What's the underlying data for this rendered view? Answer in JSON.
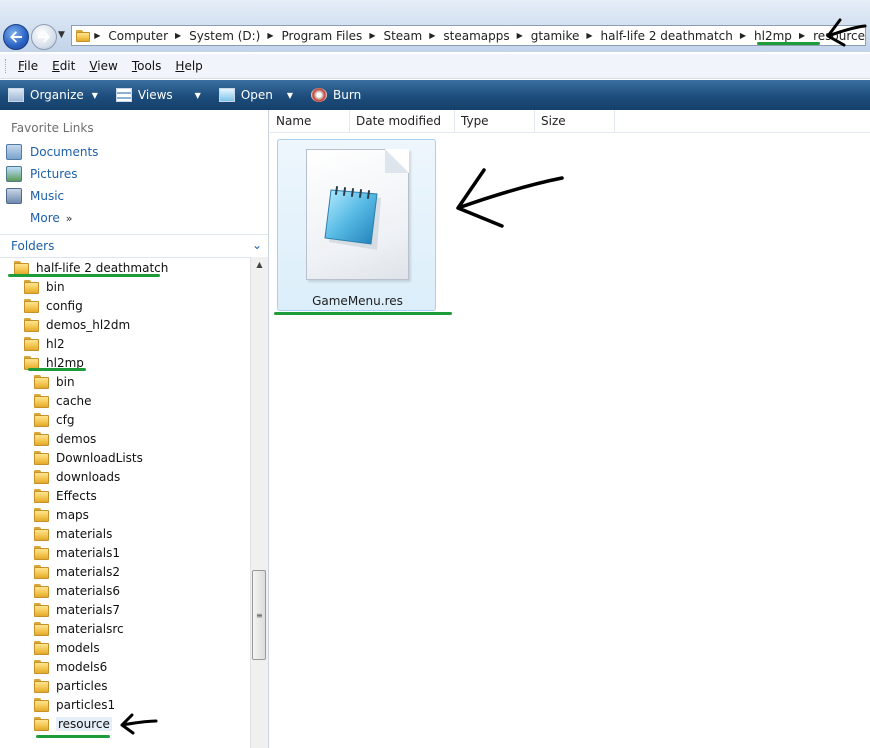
{
  "breadcrumb": [
    "Computer",
    "System (D:)",
    "Program Files",
    "Steam",
    "steamapps",
    "gtamike",
    "half-life 2 deathmatch",
    "hl2mp",
    "resource"
  ],
  "menu": [
    {
      "label": "File",
      "u": "F",
      "rest": "ile"
    },
    {
      "label": "Edit",
      "u": "E",
      "rest": "dit"
    },
    {
      "label": "View",
      "u": "V",
      "rest": "iew"
    },
    {
      "label": "Tools",
      "u": "T",
      "rest": "ools"
    },
    {
      "label": "Help",
      "u": "H",
      "rest": "elp"
    }
  ],
  "commands": {
    "organize": "Organize",
    "views": "Views",
    "open": "Open",
    "burn": "Burn"
  },
  "favorites": {
    "title": "Favorite Links",
    "documents": "Documents",
    "pictures": "Pictures",
    "music": "Music",
    "more": "More"
  },
  "folders_label": "Folders",
  "tree": [
    {
      "label": "half-life 2 deathmatch",
      "level": 0
    },
    {
      "label": "bin",
      "level": 1
    },
    {
      "label": "config",
      "level": 1
    },
    {
      "label": "demos_hl2dm",
      "level": 1
    },
    {
      "label": "hl2",
      "level": 1
    },
    {
      "label": "hl2mp",
      "level": 1
    },
    {
      "label": "bin",
      "level": 2
    },
    {
      "label": "cache",
      "level": 2
    },
    {
      "label": "cfg",
      "level": 2
    },
    {
      "label": "demos",
      "level": 2
    },
    {
      "label": "DownloadLists",
      "level": 2
    },
    {
      "label": "downloads",
      "level": 2
    },
    {
      "label": "Effects",
      "level": 2
    },
    {
      "label": "maps",
      "level": 2
    },
    {
      "label": "materials",
      "level": 2
    },
    {
      "label": "materials1",
      "level": 2
    },
    {
      "label": "materials2",
      "level": 2
    },
    {
      "label": "materials6",
      "level": 2
    },
    {
      "label": "materials7",
      "level": 2
    },
    {
      "label": "materialsrc",
      "level": 2
    },
    {
      "label": "models",
      "level": 2
    },
    {
      "label": "models6",
      "level": 2
    },
    {
      "label": "particles",
      "level": 2
    },
    {
      "label": "particles1",
      "level": 2
    },
    {
      "label": "resource",
      "level": 2,
      "selected": true
    }
  ],
  "columns": {
    "name": "Name",
    "date": "Date modified",
    "type": "Type",
    "size": "Size"
  },
  "file": {
    "name": "GameMenu.res",
    "icon": "notepad-document-icon"
  },
  "colors": {
    "annotation_underline": "#1f9c3a",
    "annotation_arrow": "#000000",
    "command_bar": "#1d4d7c"
  }
}
